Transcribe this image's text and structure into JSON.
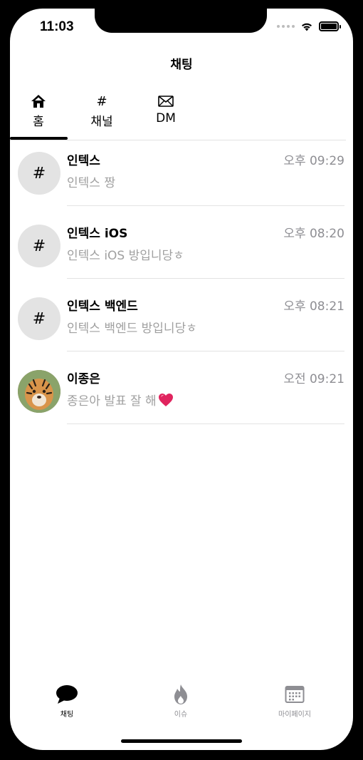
{
  "status_bar": {
    "time": "11:03"
  },
  "nav": {
    "title": "채팅"
  },
  "tabs": [
    {
      "label": "홈",
      "icon": "house-icon",
      "selected": true
    },
    {
      "label": "채널",
      "icon": "hash-icon",
      "glyph": "#",
      "selected": false
    },
    {
      "label": "DM",
      "icon": "envelope-icon",
      "selected": false
    }
  ],
  "chats": [
    {
      "name": "인텍스",
      "time": "오후 09:29",
      "preview": "인텍스 짱",
      "avatar": "#"
    },
    {
      "name": "인텍스 iOS",
      "time": "오후 08:20",
      "preview": "인텍스 iOS 방입니당ㅎ",
      "avatar": "#"
    },
    {
      "name": "인텍스 백엔드",
      "time": "오후 08:21",
      "preview": "인텍스 백엔드 방입니당ㅎ",
      "avatar": "#"
    },
    {
      "name": "이종은",
      "time": "오전 09:21",
      "preview": "종은아 발표 잘 해",
      "avatar_type": "photo",
      "preview_emoji": "red-heart-icon"
    }
  ],
  "tab_bar": [
    {
      "label": "채팅",
      "icon": "chat-bubble-icon",
      "selected": true
    },
    {
      "label": "이슈",
      "icon": "flame-icon",
      "selected": false
    },
    {
      "label": "마이페이지",
      "icon": "calendar-icon",
      "selected": false
    }
  ],
  "colors": {
    "selected": "#000000",
    "unselected": "#8e8e93",
    "avatar_bg": "#e3e3e3",
    "heart": "#e0245e"
  }
}
